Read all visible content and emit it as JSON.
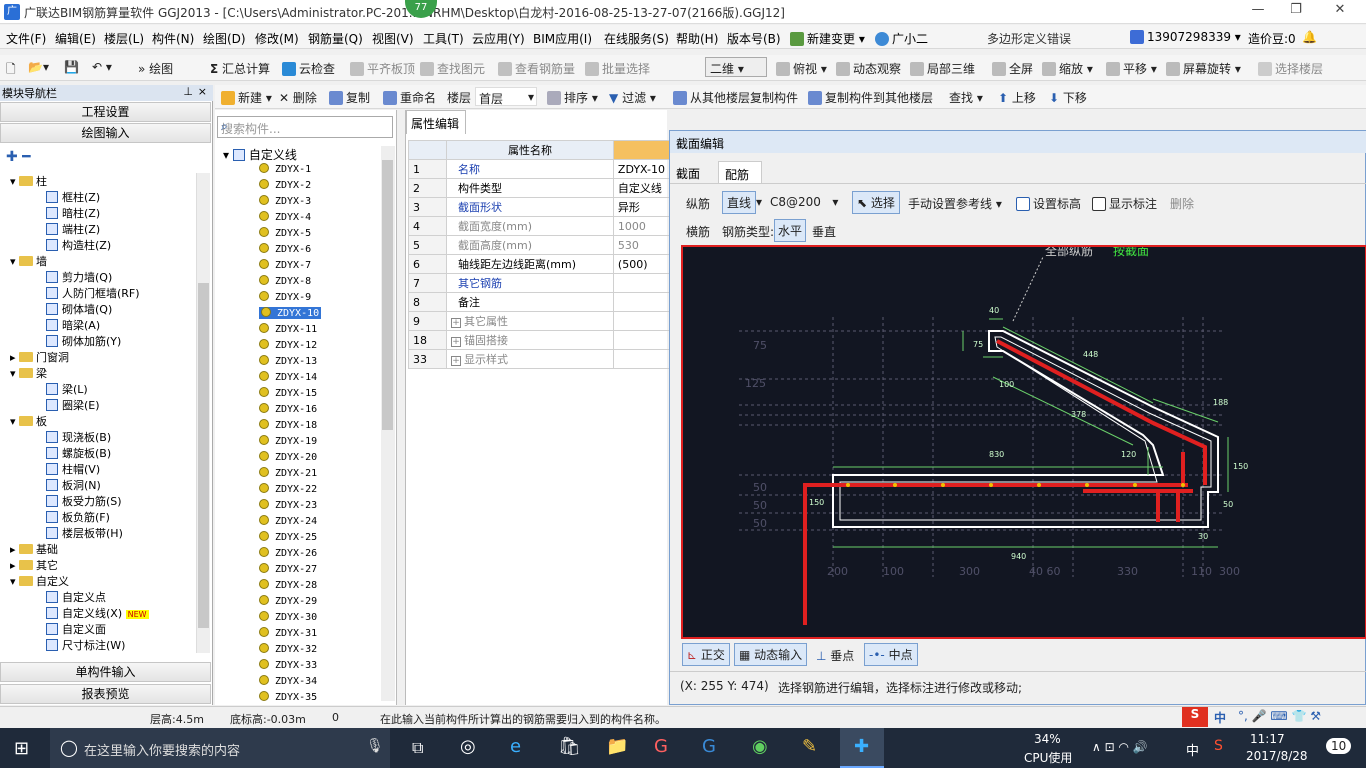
{
  "window": {
    "title": "广联达BIM钢筋算量软件 GGJ2013 - [C:\\Users\\Administrator.PC-201... NRHM\\Desktop\\白龙村-2016-08-25-13-27-07(2166版).GGJ12]",
    "badge": "77"
  },
  "menu": {
    "items": [
      "文件(F)",
      "编辑(E)",
      "楼层(L)",
      "构件(N)",
      "绘图(D)",
      "修改(M)",
      "钢筋量(Q)",
      "视图(V)",
      "工具(T)",
      "云应用(Y)",
      "BIM应用(I)",
      "在线服务(S)",
      "帮助(H)",
      "版本号(B)"
    ],
    "new_change": "新建变更",
    "assistant": "广小二",
    "error_msg": "多边形定义错误",
    "phone": "13907298339",
    "price": "造价豆:0"
  },
  "toolbar1": {
    "draw": "绘图",
    "sum": "汇总计算",
    "cloud_check": "云检查",
    "align_top": "平齐板顶",
    "find_elem": "查找图元",
    "view_rebar": "查看钢筋量",
    "batch_select": "批量选择",
    "view_mode": "二维",
    "top_view": "俯视",
    "dynamic_view": "动态观察",
    "local_3d": "局部三维",
    "full_screen": "全屏",
    "zoom": "缩放",
    "pan": "平移",
    "rotate": "屏幕旋转",
    "select_floor": "选择楼层"
  },
  "toolbar2": {
    "new": "新建",
    "delete": "删除",
    "copy": "复制",
    "rename": "重命名",
    "floor_label": "楼层",
    "floor_value": "首层",
    "sort": "排序",
    "filter": "过滤",
    "copy_from": "从其他楼层复制构件",
    "copy_to": "复制构件到其他楼层",
    "find": "查找",
    "up": "上移",
    "down": "下移"
  },
  "nav": {
    "header": "模块导航栏",
    "project_settings": "工程设置",
    "draw_input": "绘图输入",
    "single_input": "单构件输入",
    "report_preview": "报表预览",
    "tree": [
      {
        "label": "柱",
        "type": "folder",
        "open": true
      },
      {
        "label": "框柱(Z)",
        "type": "leaf"
      },
      {
        "label": "暗柱(Z)",
        "type": "leaf"
      },
      {
        "label": "端柱(Z)",
        "type": "leaf"
      },
      {
        "label": "构造柱(Z)",
        "type": "leaf"
      },
      {
        "label": "墙",
        "type": "folder",
        "open": true
      },
      {
        "label": "剪力墙(Q)",
        "type": "leaf"
      },
      {
        "label": "人防门框墙(RF)",
        "type": "leaf"
      },
      {
        "label": "砌体墙(Q)",
        "type": "leaf"
      },
      {
        "label": "暗梁(A)",
        "type": "leaf"
      },
      {
        "label": "砌体加筋(Y)",
        "type": "leaf"
      },
      {
        "label": "门窗洞",
        "type": "folder",
        "open": false
      },
      {
        "label": "梁",
        "type": "folder",
        "open": true
      },
      {
        "label": "梁(L)",
        "type": "leaf"
      },
      {
        "label": "圈梁(E)",
        "type": "leaf"
      },
      {
        "label": "板",
        "type": "folder",
        "open": true
      },
      {
        "label": "现浇板(B)",
        "type": "leaf"
      },
      {
        "label": "螺旋板(B)",
        "type": "leaf"
      },
      {
        "label": "柱帽(V)",
        "type": "leaf"
      },
      {
        "label": "板洞(N)",
        "type": "leaf"
      },
      {
        "label": "板受力筋(S)",
        "type": "leaf"
      },
      {
        "label": "板负筋(F)",
        "type": "leaf"
      },
      {
        "label": "楼层板带(H)",
        "type": "leaf"
      },
      {
        "label": "基础",
        "type": "folder",
        "open": false
      },
      {
        "label": "其它",
        "type": "folder",
        "open": false
      },
      {
        "label": "自定义",
        "type": "folder",
        "open": true
      },
      {
        "label": "自定义点",
        "type": "leaf"
      },
      {
        "label": "自定义线(X)",
        "type": "leaf",
        "new": "NEW"
      },
      {
        "label": "自定义面",
        "type": "leaf"
      },
      {
        "label": "尺寸标注(W)",
        "type": "leaf"
      }
    ]
  },
  "list": {
    "search_placeholder": "搜索构件...",
    "root": "自定义线",
    "items": [
      "ZDYX-1",
      "ZDYX-2",
      "ZDYX-3",
      "ZDYX-4",
      "ZDYX-5",
      "ZDYX-6",
      "ZDYX-7",
      "ZDYX-8",
      "ZDYX-9",
      "ZDYX-10",
      "ZDYX-11",
      "ZDYX-12",
      "ZDYX-13",
      "ZDYX-14",
      "ZDYX-15",
      "ZDYX-16",
      "ZDYX-18",
      "ZDYX-19",
      "ZDYX-20",
      "ZDYX-21",
      "ZDYX-22",
      "ZDYX-23",
      "ZDYX-24",
      "ZDYX-25",
      "ZDYX-26",
      "ZDYX-27",
      "ZDYX-28",
      "ZDYX-29",
      "ZDYX-30",
      "ZDYX-31",
      "ZDYX-32",
      "ZDYX-33",
      "ZDYX-34",
      "ZDYX-35"
    ],
    "selected": "ZDYX-10"
  },
  "props": {
    "tab": "属性编辑",
    "header_name": "属性名称",
    "rows": [
      {
        "num": "1",
        "name": "名称",
        "value": "ZDYX-10",
        "blue": true
      },
      {
        "num": "2",
        "name": "构件类型",
        "value": "自定义线",
        "blue": false
      },
      {
        "num": "3",
        "name": "截面形状",
        "value": "异形",
        "blue": true
      },
      {
        "num": "4",
        "name": "截面宽度(mm)",
        "value": "1000",
        "blue": false,
        "gray": true
      },
      {
        "num": "5",
        "name": "截面高度(mm)",
        "value": "530",
        "blue": false,
        "gray": true
      },
      {
        "num": "6",
        "name": "轴线距左边线距离(mm)",
        "value": "(500)",
        "blue": false
      },
      {
        "num": "7",
        "name": "其它钢筋",
        "value": "",
        "blue": true
      },
      {
        "num": "8",
        "name": "备注",
        "value": "",
        "blue": false
      },
      {
        "num": "9",
        "name": "其它属性",
        "value": "",
        "blue": false,
        "gray": true,
        "expand": true
      },
      {
        "num": "18",
        "name": "锚固搭接",
        "value": "",
        "blue": false,
        "gray": true,
        "expand": true
      },
      {
        "num": "33",
        "name": "显示样式",
        "value": "",
        "blue": false,
        "gray": true,
        "expand": true
      }
    ]
  },
  "dialog": {
    "title": "截面编辑",
    "tabs": [
      "截面",
      "配筋"
    ],
    "active_tab": "配筋",
    "row1": {
      "zongjin": "纵筋",
      "line": "直线",
      "spec": "C8@200",
      "select": "选择",
      "ref": "手动设置参考线",
      "elev": "设置标高",
      "show_mark": "显示标注",
      "delete": "删除"
    },
    "row2": {
      "hengjin": "横筋",
      "type_label": "钢筋类型:",
      "horizontal": "水平",
      "vertical": "垂直"
    },
    "canvas_note": "全部纵筋",
    "canvas_note2": "按截面",
    "bottom": {
      "ortho": "正交",
      "dyn_input": "动态输入",
      "perp": "垂点",
      "mid": "中点"
    },
    "coords": "(X: 255 Y: 474)",
    "hint": "选择钢筋进行编辑，选择标注进行修改或移动;",
    "dims": {
      "d40": "40",
      "d75": "75",
      "d448": "448",
      "d100": "100",
      "d188": "188",
      "d378": "378",
      "d830": "830",
      "d120": "120",
      "d150": "150",
      "d50": "50",
      "d30": "30",
      "d940": "940",
      "d750": "150"
    },
    "left_ticks": [
      "75",
      "125",
      "50",
      "50",
      "50"
    ],
    "bottom_ticks": [
      "200",
      "100",
      "300",
      "40 60",
      "330",
      "110",
      "300"
    ]
  },
  "status": {
    "floor_height": "层高:4.5m",
    "bottom_elev": "底标高:-0.03m",
    "zero": "0",
    "message": "在此输入当前构件所计算出的钢筋需要归入到的构件名称。",
    "ime": "中"
  },
  "taskbar": {
    "search": "在这里输入你要搜索的内容",
    "cpu_pct": "34%",
    "cpu_label": "CPU使用",
    "ime": "中",
    "time": "11:17",
    "date": "2017/8/28",
    "notif": "10"
  }
}
